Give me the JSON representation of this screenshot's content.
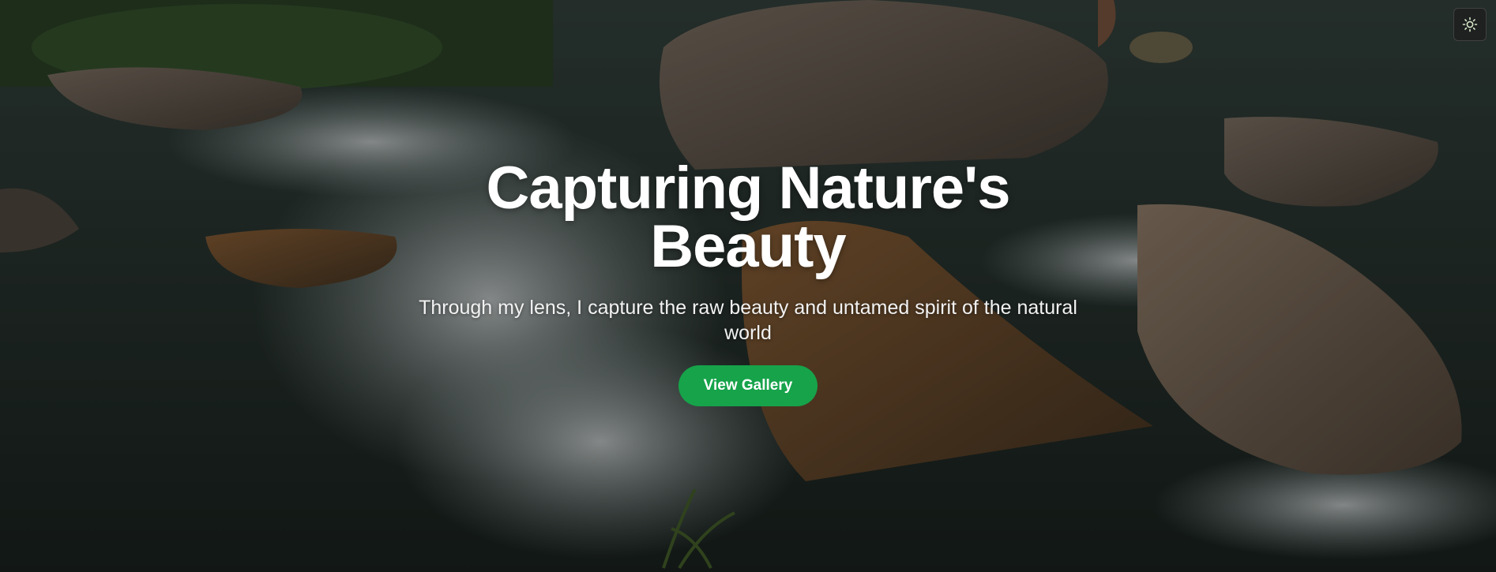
{
  "hero": {
    "title": "Capturing Nature's Beauty",
    "subtitle": "Through my lens, I capture the raw beauty and untamed spirit of the natural world",
    "cta_label": "View Gallery",
    "background_image": "river-rocks-photo",
    "overlay_color": "#000000"
  },
  "theme_toggle": {
    "icon": "sun-icon"
  },
  "colors": {
    "accent": "#16a34a",
    "text": "#ffffff"
  }
}
